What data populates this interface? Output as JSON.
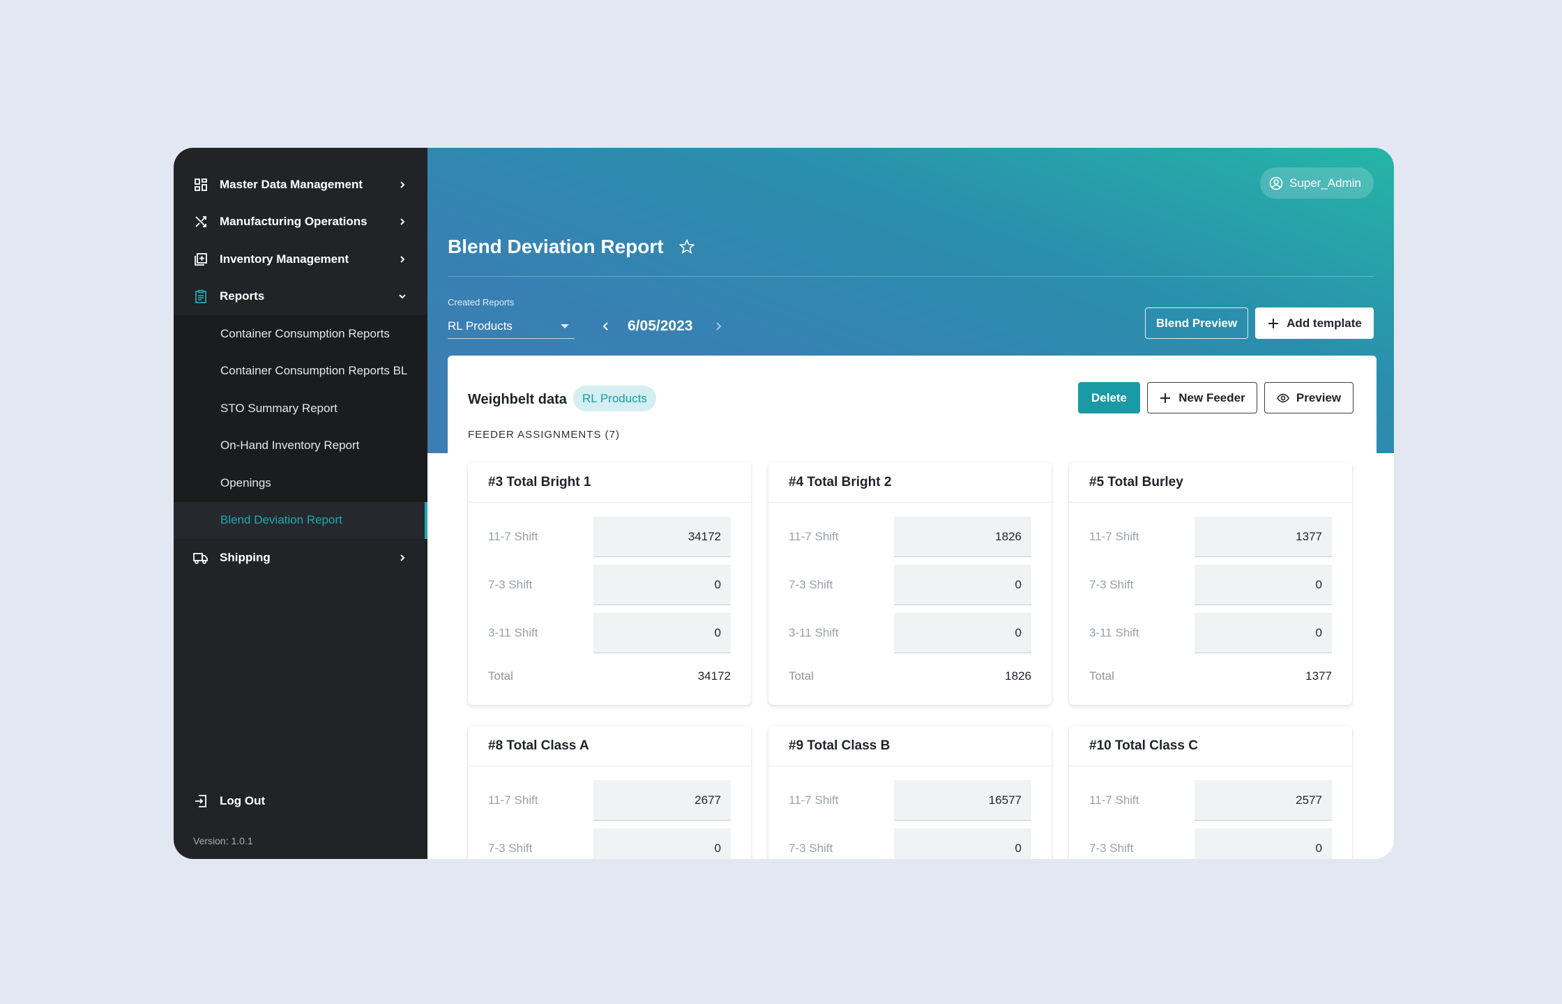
{
  "sidebar": {
    "items": [
      {
        "label": "Master Data Management"
      },
      {
        "label": "Manufacturing Operations"
      },
      {
        "label": "Inventory Management"
      },
      {
        "label": "Reports"
      }
    ],
    "reports_sub": [
      {
        "label": "Container Consumption Reports"
      },
      {
        "label": "Container Consumption Reports BL"
      },
      {
        "label": "STO Summary Report"
      },
      {
        "label": "On-Hand Inventory Report"
      },
      {
        "label": "Openings"
      },
      {
        "label": "Blend Deviation Report"
      }
    ],
    "shipping": {
      "label": "Shipping"
    },
    "logout": "Log Out",
    "version": "Version: 1.0.1"
  },
  "header": {
    "user": "Super_Admin",
    "title": "Blend Deviation Report",
    "created_label": "Created Reports",
    "selected_report": "RL Products",
    "date": "6/05/2023",
    "blend_preview": "Blend Preview",
    "add_template": "Add template"
  },
  "panel": {
    "title": "Weighbelt data",
    "tag": "RL Products",
    "delete": "Delete",
    "new_feeder": "New Feeder",
    "preview": "Preview",
    "assignments_label": "FEEDER ASSIGNMENTS (7)",
    "feeders": [
      {
        "title": "#3 Total Bright 1",
        "shift1_label": "11-7 Shift",
        "shift1": "34172",
        "shift2_label": "7-3 Shift",
        "shift2": "0",
        "shift3_label": "3-11 Shift",
        "shift3": "0",
        "total_label": "Total",
        "total": "34172"
      },
      {
        "title": "#4 Total Bright 2",
        "shift1_label": "11-7 Shift",
        "shift1": "1826",
        "shift2_label": "7-3 Shift",
        "shift2": "0",
        "shift3_label": "3-11 Shift",
        "shift3": "0",
        "total_label": "Total",
        "total": "1826"
      },
      {
        "title": "#5 Total Burley",
        "shift1_label": "11-7 Shift",
        "shift1": "1377",
        "shift2_label": "7-3 Shift",
        "shift2": "0",
        "shift3_label": "3-11 Shift",
        "shift3": "0",
        "total_label": "Total",
        "total": "1377"
      },
      {
        "title": "#8 Total Class A",
        "shift1_label": "11-7 Shift",
        "shift1": "2677",
        "shift2_label": "7-3 Shift",
        "shift2": "0"
      },
      {
        "title": "#9 Total Class B",
        "shift1_label": "11-7 Shift",
        "shift1": "16577",
        "shift2_label": "7-3 Shift",
        "shift2": "0"
      },
      {
        "title": "#10 Total Class C",
        "shift1_label": "11-7 Shift",
        "shift1": "2577",
        "shift2_label": "7-3 Shift",
        "shift2": "0"
      }
    ]
  },
  "colors": {
    "accent": "#1a9aa4",
    "sidebar_bg": "#212326",
    "page_bg": "#e3e7f2"
  },
  "icons": [
    "dashboard-icon",
    "shuffle-icon",
    "inventory-icon",
    "clipboard-icon",
    "chevron-right-icon",
    "chevron-down-icon",
    "truck-icon",
    "logout-icon",
    "user-circle-icon",
    "star-icon",
    "plus-icon",
    "eye-icon"
  ]
}
